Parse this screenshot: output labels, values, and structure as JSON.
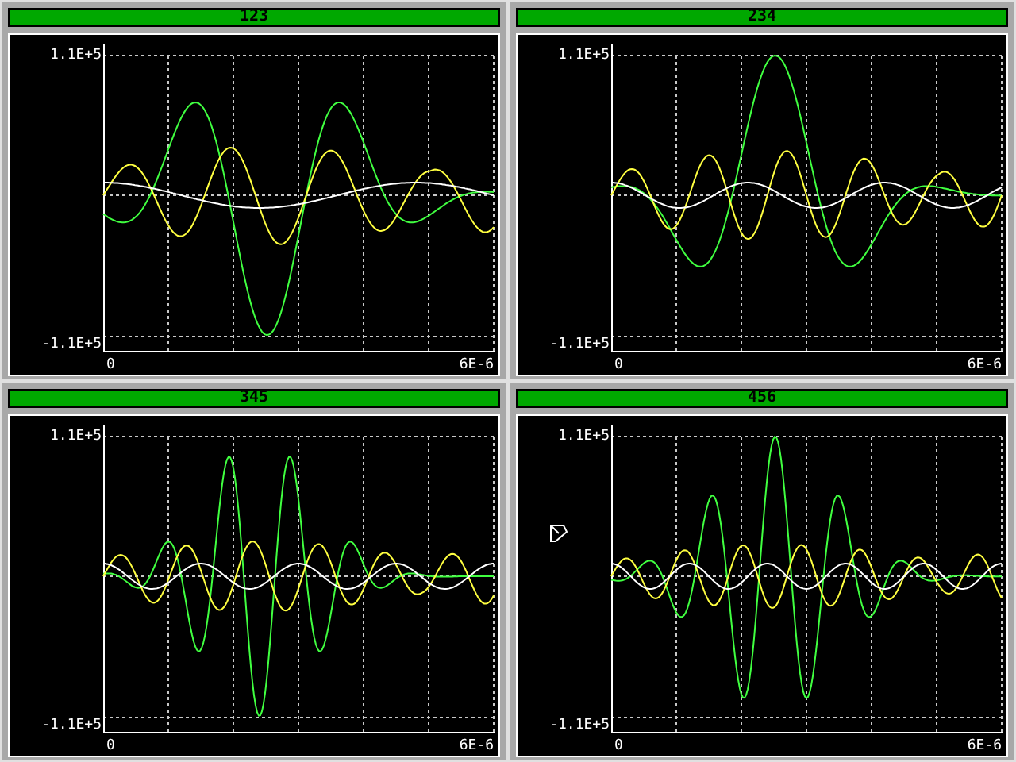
{
  "panels": [
    {
      "title": "123",
      "y_max_label": "1.1E+5",
      "y_min_label": "-1.1E+5",
      "x_min_label": "0",
      "x_max_label": "6E-6",
      "pointer": false
    },
    {
      "title": "234",
      "y_max_label": "1.1E+5",
      "y_min_label": "-1.1E+5",
      "x_min_label": "0",
      "x_max_label": "6E-6",
      "pointer": false
    },
    {
      "title": "345",
      "y_max_label": "1.1E+5",
      "y_min_label": "-1.1E+5",
      "x_min_label": "0",
      "x_max_label": "6E-6",
      "pointer": false
    },
    {
      "title": "456",
      "y_max_label": "1.1E+5",
      "y_min_label": "-1.1E+5",
      "x_min_label": "0",
      "x_max_label": "6E-6",
      "pointer": true
    }
  ]
}
